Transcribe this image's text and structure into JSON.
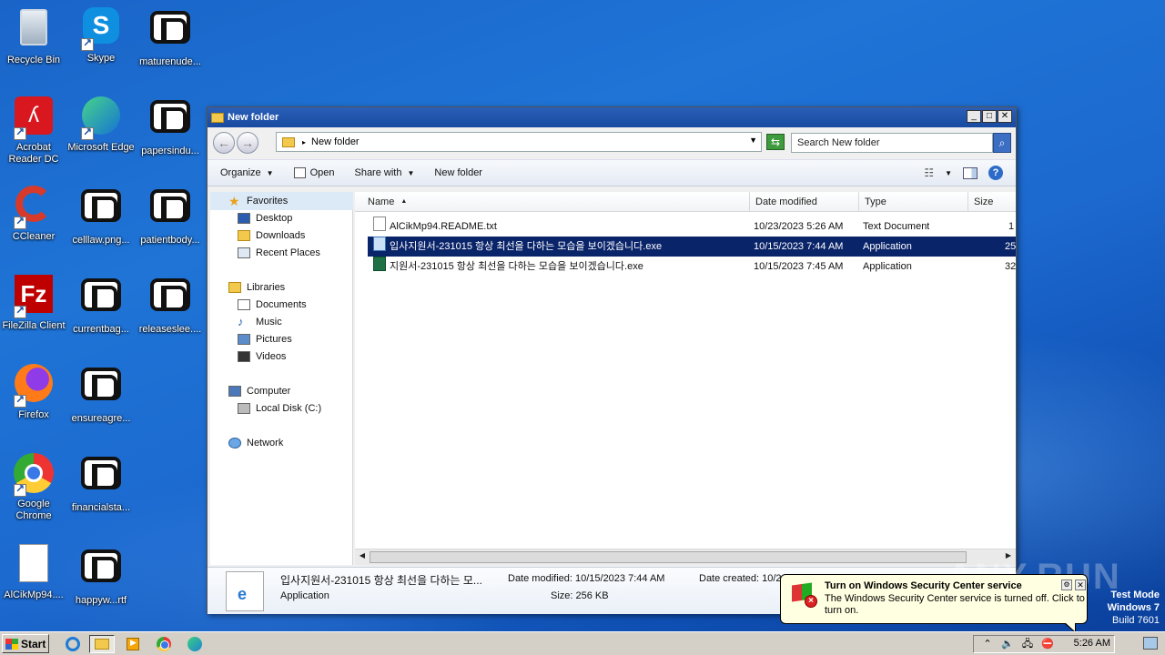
{
  "desktop": {
    "icons": [
      {
        "label": "Recycle Bin"
      },
      {
        "label": "Skype"
      },
      {
        "label": "maturenude..."
      },
      {
        "label": "Acrobat Reader DC"
      },
      {
        "label": "Microsoft Edge"
      },
      {
        "label": "papersindu..."
      },
      {
        "label": "CCleaner"
      },
      {
        "label": "celllaw.png..."
      },
      {
        "label": "patientbody..."
      },
      {
        "label": "FileZilla Client"
      },
      {
        "label": "currentbag..."
      },
      {
        "label": "releaseslee...."
      },
      {
        "label": "Firefox"
      },
      {
        "label": "ensureagre..."
      },
      {
        "label": "Google Chrome"
      },
      {
        "label": "financialsta..."
      },
      {
        "label": "AlCikMp94...."
      },
      {
        "label": "happyw...rtf"
      }
    ]
  },
  "window": {
    "title": "New folder",
    "buttons": {
      "minimize": "_",
      "maximize": "□",
      "close": "✕"
    },
    "address": "New folder",
    "search_placeholder": "Search New folder",
    "toolbar": {
      "organize": "Organize",
      "open": "Open",
      "share_with": "Share with",
      "new_folder": "New folder"
    },
    "nav": {
      "favorites": "Favorites",
      "desktop": "Desktop",
      "downloads": "Downloads",
      "recent_places": "Recent Places",
      "libraries": "Libraries",
      "documents": "Documents",
      "music": "Music",
      "pictures": "Pictures",
      "videos": "Videos",
      "computer": "Computer",
      "local_disk": "Local Disk (C:)",
      "network": "Network"
    },
    "columns": {
      "name": "Name",
      "date_modified": "Date modified",
      "type": "Type",
      "size": "Size"
    },
    "files": [
      {
        "name": "AlCikMp94.README.txt",
        "date": "10/23/2023 5:26 AM",
        "type": "Text Document",
        "size": "1"
      },
      {
        "name": "입사지원서-231015 항상 최선을 다하는 모습을 보이겠습니다.exe",
        "date": "10/15/2023 7:44 AM",
        "type": "Application",
        "size": "25"
      },
      {
        "name": "지원서-231015 항상 최선을 다하는 모습을 보이겠습니다.exe",
        "date": "10/15/2023 7:45 AM",
        "type": "Application",
        "size": "32"
      }
    ],
    "details": {
      "name": "입사지원서-231015 항상 최선을 다하는 모...",
      "type": "Application",
      "date_modified": "Date modified: 10/15/2023 7:44 AM",
      "size": "Size: 256 KB",
      "date_created": "Date created: 10/2"
    }
  },
  "balloon": {
    "title": "Turn on Windows Security Center service",
    "text": "The Windows Security Center service is turned off. Click to turn on."
  },
  "taskbar": {
    "start": "Start",
    "clock": "5:26 AM"
  },
  "watermark": "ANY.RUN",
  "test_mode": {
    "line1": "Test Mode",
    "line2": "Windows 7",
    "line3": "Build 7601"
  }
}
